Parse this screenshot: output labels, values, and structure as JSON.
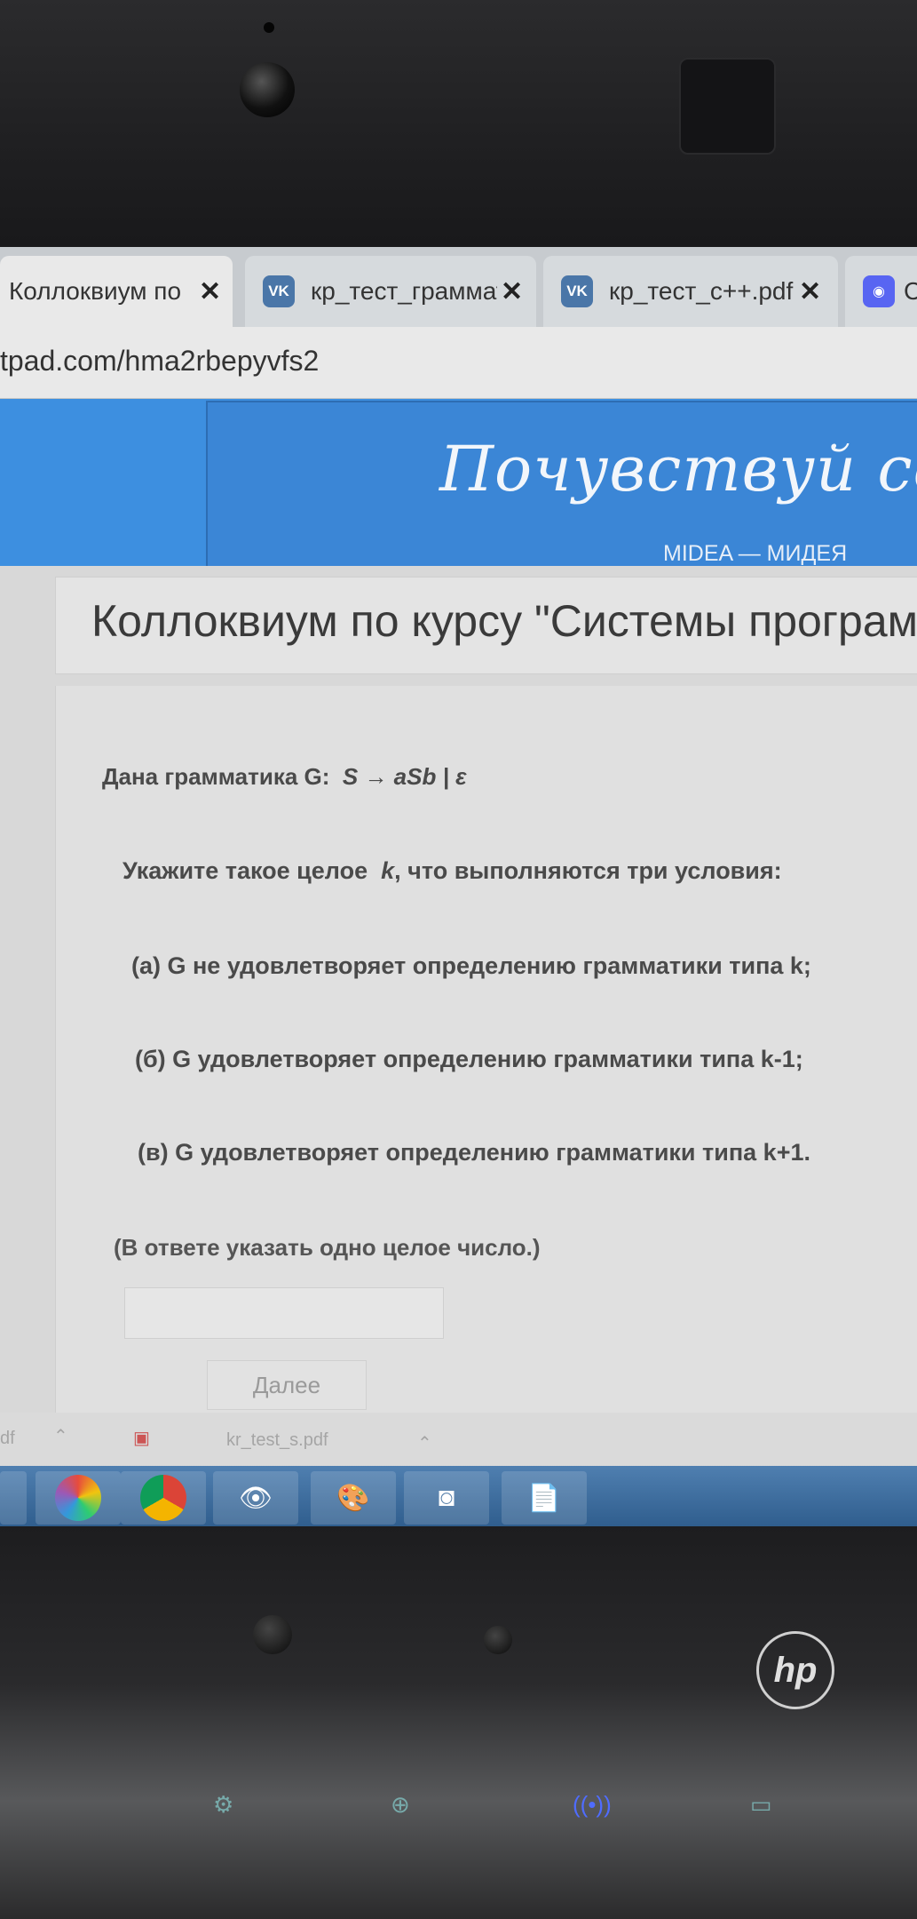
{
  "browser": {
    "tabs": [
      {
        "label": "Коллоквиум по ку",
        "active": true
      },
      {
        "label": "кр_тест_граммати",
        "icon": "vk-icon"
      },
      {
        "label": "кр_тест_с++.pdf",
        "icon": "vk-icon"
      },
      {
        "label": "С",
        "icon": "discord-icon"
      }
    ],
    "close_symbol": "✕",
    "address": "tpad.com/hma2rbepyvfs2"
  },
  "banner": {
    "script_text": "Почувствуй себе",
    "subtitle": "MIDEA — МИДЕЯ"
  },
  "page": {
    "title": "Коллоквиум по курсу \"Системы програм",
    "grammar_prefix": "Дана грамматика G:",
    "grammar_rule": "S → aSb | ε",
    "instruction_a": "Укажите такое целое",
    "instruction_k": "k",
    "instruction_b": ", что  выполняются три условия:",
    "condition_a": "(а) G не удовлетворяет определению грамматики типа k;",
    "condition_b": "(б) G  удовлетворяет определению грамматики типа  k-1;",
    "condition_c": "(в) G удовлетворяет определению  грамматики типа  k+1.",
    "note": "(В ответе указать одно целое число.)",
    "answer_value": "",
    "next_button": "Далее"
  },
  "downloads": {
    "item1": "df",
    "item2": "kr_test_s.pdf"
  },
  "colors": {
    "header_blue": "#3d8fe0",
    "taskbar_blue": "#2f5d8d"
  }
}
